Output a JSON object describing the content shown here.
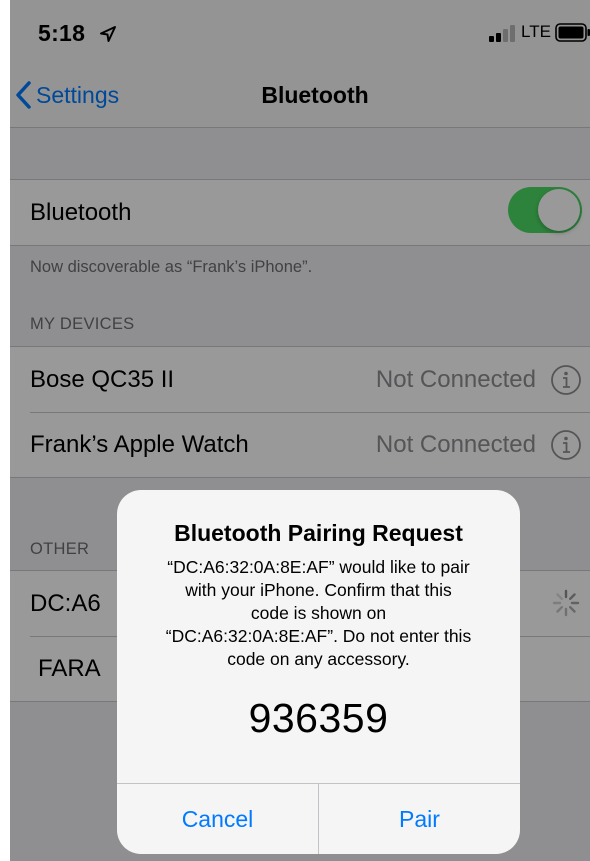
{
  "status_bar": {
    "time": "5:18",
    "network": "LTE",
    "icons": [
      "location-arrow-icon",
      "signal-bars-icon",
      "battery-icon"
    ]
  },
  "nav": {
    "back_label": "Settings",
    "title": "Bluetooth"
  },
  "bluetooth_row": {
    "label": "Bluetooth",
    "toggle_on": true
  },
  "discoverable_note": "Now discoverable as “Frank’s iPhone”.",
  "my_devices": {
    "header": "MY DEVICES",
    "items": [
      {
        "name": "Bose QC35 II",
        "status": "Not Connected"
      },
      {
        "name": "Frank’s Apple Watch",
        "status": "Not Connected"
      }
    ]
  },
  "other_devices": {
    "header": "OTHER",
    "items": [
      {
        "name": "DC:A6"
      },
      {
        "name": "FARA"
      }
    ]
  },
  "alert": {
    "title": "Bluetooth Pairing Request",
    "message": "“DC:A6:32:0A:8E:AF” would like to pair\nwith your iPhone. Confirm that this\ncode is shown on\n“DC:A6:32:0A:8E:AF”. Do not enter this\ncode on any accessory.",
    "code": "936359",
    "cancel_label": "Cancel",
    "pair_label": "Pair"
  },
  "colors": {
    "accent": "#007aff",
    "toggle_on": "#4cd964",
    "background": "#efeff4",
    "secondary_text": "#8e8e93"
  }
}
